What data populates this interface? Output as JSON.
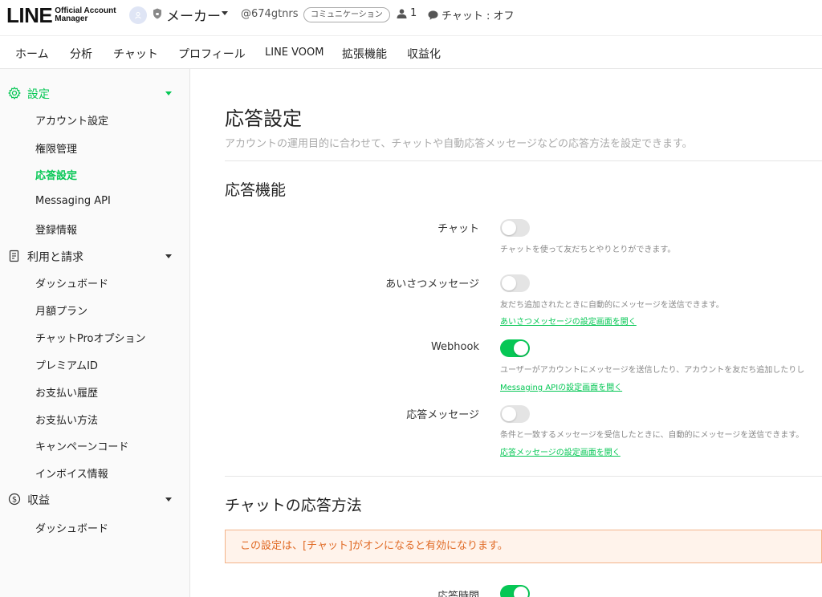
{
  "header": {
    "logo_main": "LINE",
    "logo_sub_line1": "Official Account",
    "logo_sub_line2": "Manager",
    "account_name": "メーカー",
    "account_id": "@674gtnrs",
    "account_type_badge": "コミュニケーション",
    "friend_count": "1",
    "chat_status": "チャット : オフ"
  },
  "nav": {
    "items": [
      {
        "label": "ホーム"
      },
      {
        "label": "分析"
      },
      {
        "label": "チャット"
      },
      {
        "label": "プロフィール"
      },
      {
        "label": "LINE VOOM"
      },
      {
        "label": "拡張機能"
      },
      {
        "label": "収益化"
      }
    ]
  },
  "sidebar": {
    "sections": [
      {
        "label": "設定",
        "icon": "gear-icon",
        "items": [
          "アカウント設定",
          "権限管理",
          "応答設定",
          "Messaging API",
          "登録情報"
        ]
      },
      {
        "label": "利用と請求",
        "icon": "document-icon",
        "items": [
          "ダッシュボード",
          "月額プラン",
          "チャットProオプション",
          "プレミアムID",
          "お支払い履歴",
          "お支払い方法",
          "キャンペーンコード",
          "インボイス情報"
        ]
      },
      {
        "label": "収益",
        "icon": "dollar-icon",
        "items": [
          "ダッシュボード"
        ]
      }
    ],
    "active_item": "応答設定"
  },
  "main": {
    "title": "応答設定",
    "description": "アカウントの運用目的に合わせて、チャットや自動応答メッセージなどの応答方法を設定できます。",
    "section1_title": "応答機能",
    "rows": [
      {
        "label": "チャット",
        "on": false,
        "desc": "チャットを使って友だちとやりとりができます。",
        "link": ""
      },
      {
        "label": "あいさつメッセージ",
        "on": false,
        "desc": "友だち追加されたときに自動的にメッセージを送信できます。",
        "link": "あいさつメッセージの設定画面を開く"
      },
      {
        "label": "Webhook",
        "on": true,
        "desc": "ユーザーがアカウントにメッセージを送信したり、アカウントを友だち追加したりし",
        "link": "Messaging APIの設定画面を開く"
      },
      {
        "label": "応答メッセージ",
        "on": false,
        "desc": "条件と一致するメッセージを受信したときに、自動的にメッセージを送信できます。",
        "link": "応答メッセージの設定画面を開く"
      }
    ],
    "section2_title": "チャットの応答方法",
    "notice": "この設定は、[チャット]がオンになると有効になります。",
    "response_hours_label": "応答時間",
    "response_hours_on": true
  },
  "colors": {
    "accent": "#06c755",
    "notice_bg": "#fff3eb",
    "notice_text": "#e06a25"
  }
}
